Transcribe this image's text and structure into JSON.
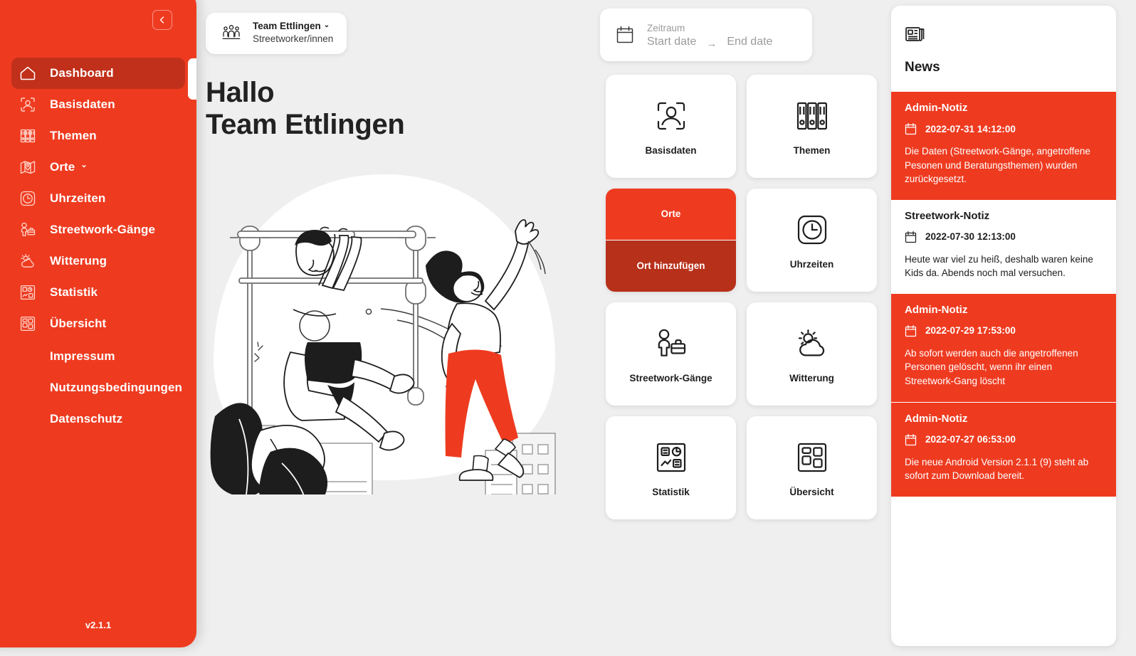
{
  "colors": {
    "brand_red": "#EE3B20",
    "brand_red_dark": "#B7301A",
    "active_nav": "#C1301A",
    "page_bg": "#EFEFEF",
    "card_bg": "#FFFFFF",
    "text_dark": "#1D1D1D",
    "text_muted": "#9B9B9B"
  },
  "sidebar": {
    "collapse_icon": "chevron-left-icon",
    "version": "v2.1.1",
    "items": [
      {
        "label": "Dashboard",
        "icon": "home-icon",
        "active": true,
        "caret": ""
      },
      {
        "label": "Basisdaten",
        "icon": "person-scan-icon",
        "active": false,
        "caret": ""
      },
      {
        "label": "Themen",
        "icon": "binders-icon",
        "active": false,
        "caret": ""
      },
      {
        "label": "Orte",
        "icon": "map-pin-icon",
        "active": false,
        "caret": "⌄"
      },
      {
        "label": "Uhrzeiten",
        "icon": "clock-icon",
        "active": false,
        "caret": ""
      },
      {
        "label": "Streetwork-Gänge",
        "icon": "person-briefcase-icon",
        "active": false,
        "caret": ""
      },
      {
        "label": "Witterung",
        "icon": "weather-cloud-icon",
        "active": false,
        "caret": ""
      },
      {
        "label": "Statistik",
        "icon": "statistics-icon",
        "active": false,
        "caret": ""
      },
      {
        "label": "Übersicht",
        "icon": "grid-overview-icon",
        "active": false,
        "caret": ""
      }
    ],
    "links": [
      {
        "label": "Impressum"
      },
      {
        "label": "Nutzungsbedingungen"
      },
      {
        "label": "Datenschutz"
      }
    ]
  },
  "team_selector": {
    "icon": "group-people-icon",
    "name": "Team Ettlingen",
    "caret": "⌄",
    "role": "Streetworker/innen"
  },
  "date_range": {
    "icon": "calendar-icon",
    "label": "Zeitraum",
    "start_placeholder": "Start date",
    "arrow": "→",
    "end_placeholder": "End date",
    "start_value": "",
    "end_value": ""
  },
  "hero": {
    "greeting": "Hallo",
    "name": "Team Ettlingen",
    "illustration": "playground-streetwork-illustration"
  },
  "tiles": [
    {
      "label": "Basisdaten",
      "icon": "person-scan-icon",
      "type": "normal"
    },
    {
      "label": "Themen",
      "icon": "binders-icon",
      "type": "normal"
    },
    {
      "label": "Orte",
      "icon": "",
      "type": "split",
      "sub_label": "Ort hinzufügen"
    },
    {
      "label": "Uhrzeiten",
      "icon": "clock-icon",
      "type": "normal"
    },
    {
      "label": "Streetwork-Gänge",
      "icon": "person-briefcase-icon",
      "type": "normal"
    },
    {
      "label": "Witterung",
      "icon": "weather-cloud-icon",
      "type": "normal"
    },
    {
      "label": "Statistik",
      "icon": "statistics-icon",
      "type": "normal"
    },
    {
      "label": "Übersicht",
      "icon": "grid-overview-icon",
      "type": "normal"
    }
  ],
  "news": {
    "icon": "newspaper-icon",
    "title": "News",
    "items": [
      {
        "heading": "Admin-Notiz",
        "date": "2022-07-31 14:12:00",
        "body": "Die Daten (Streetwork-Gänge, angetroffene Pesonen und Beratungsthemen) wurden zurückgesetzt.",
        "style": "red"
      },
      {
        "heading": "Streetwork-Notiz",
        "date": "2022-07-30 12:13:00",
        "body": "Heute war viel zu heiß, deshalb waren keine Kids da. Abends noch mal versuchen.",
        "style": "white"
      },
      {
        "heading": "Admin-Notiz",
        "date": "2022-07-29 17:53:00",
        "body": "Ab sofort werden auch die angetroffenen Personen gelöscht, wenn ihr einen Streetwork-Gang löscht",
        "style": "red"
      },
      {
        "heading": "Admin-Notiz",
        "date": "2022-07-27 06:53:00",
        "body": "Die neue Android Version 2.1.1 (9) steht ab sofort zum Download bereit.",
        "style": "red"
      }
    ]
  }
}
